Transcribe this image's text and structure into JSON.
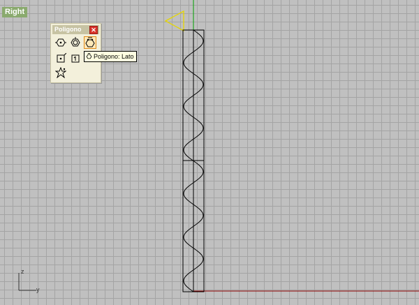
{
  "viewport": {
    "label": "Right"
  },
  "toolbar": {
    "title": "Poligono",
    "close_glyph": "✕",
    "buttons": [
      {
        "name": "polygon-center-icon"
      },
      {
        "name": "polygon-circumscribed-icon"
      },
      {
        "name": "polygon-edge-icon",
        "active": true
      },
      {
        "name": "rectangle-polygon-icon"
      },
      {
        "name": "square-polygon-icon"
      },
      {
        "name": "star-icon"
      }
    ]
  },
  "tooltip": {
    "text": "Poligono: Lato",
    "icon": "polygon-edge-icon"
  },
  "axes": {
    "vertical": "z",
    "horizontal": "y"
  },
  "colors": {
    "grid_background": "#c0c0c0",
    "grid_line": "#a4a4a4",
    "label_bg": "#8aaa6e",
    "x_axis": "#8b0000",
    "y_axis_green": "#00a000",
    "camera_yellow": "#e6d600",
    "geometry": "#000000"
  }
}
